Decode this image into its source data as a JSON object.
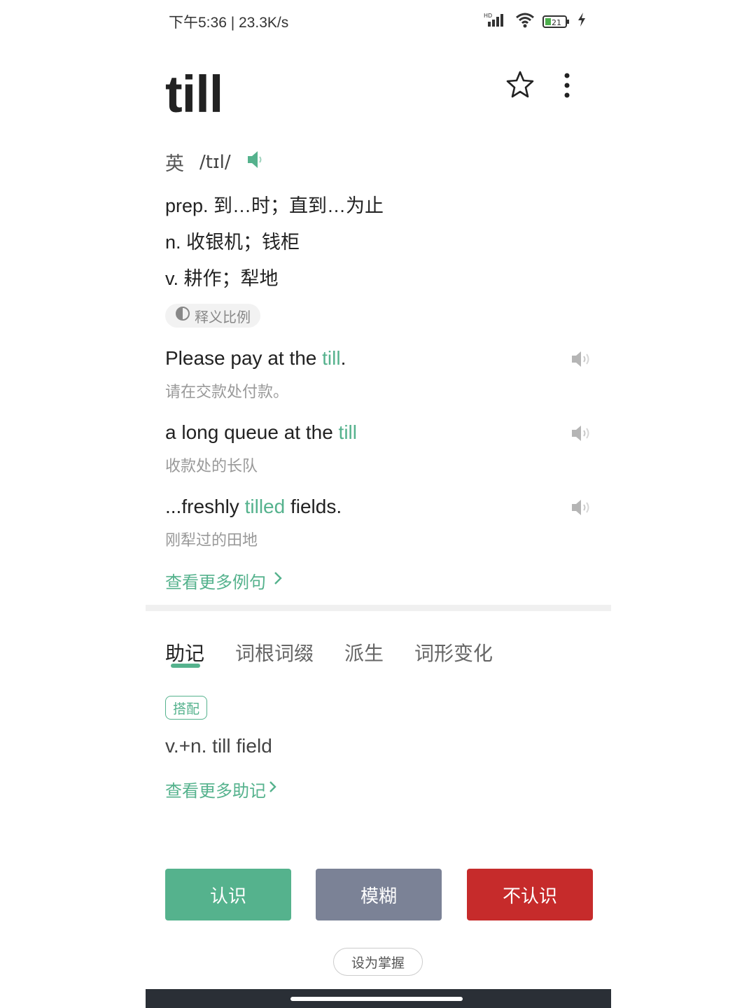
{
  "status_bar": {
    "time_speed": "下午5:36 | 23.3K/s",
    "hd_label": "HD",
    "battery": "21"
  },
  "word": {
    "headword": "till",
    "accent": "英",
    "phonetic": "/tɪl/"
  },
  "definitions": [
    {
      "text": "prep. 到…时；直到…为止"
    },
    {
      "text": "n. 收银机；钱柜"
    },
    {
      "text": "v. 耕作；犁地"
    }
  ],
  "ratio_chip": {
    "label": "释义比例"
  },
  "examples": [
    {
      "before": "Please pay at the ",
      "highlight": "till",
      "after": ".",
      "translation": "请在交款处付款。"
    },
    {
      "before": "a long queue at the ",
      "highlight": "till",
      "after": "",
      "translation": "收款处的长队"
    },
    {
      "before": "...freshly ",
      "highlight": "tilled",
      "after": " fields.",
      "translation": "刚犁过的田地"
    }
  ],
  "more_examples": {
    "label": "查看更多例句"
  },
  "tabs": [
    {
      "label": "助记"
    },
    {
      "label": "词根词缀"
    },
    {
      "label": "派生"
    },
    {
      "label": "词形变化"
    }
  ],
  "mnemonic": {
    "badge": "搭配",
    "collocation": "v.+n. till field",
    "more_label": "查看更多助记"
  },
  "actions": {
    "know": "认识",
    "vague": "模糊",
    "unknown": "不认识",
    "set_mastered": "设为掌握"
  },
  "colors": {
    "accent": "#55b28d",
    "know": "#55b28d",
    "vague": "#7b8296",
    "unknown": "#c62b2b"
  },
  "icons": [
    "star-icon",
    "more-vertical-icon",
    "speaker-icon",
    "chevron-right-icon",
    "signal-icon",
    "wifi-icon",
    "battery-icon",
    "charging-icon"
  ]
}
